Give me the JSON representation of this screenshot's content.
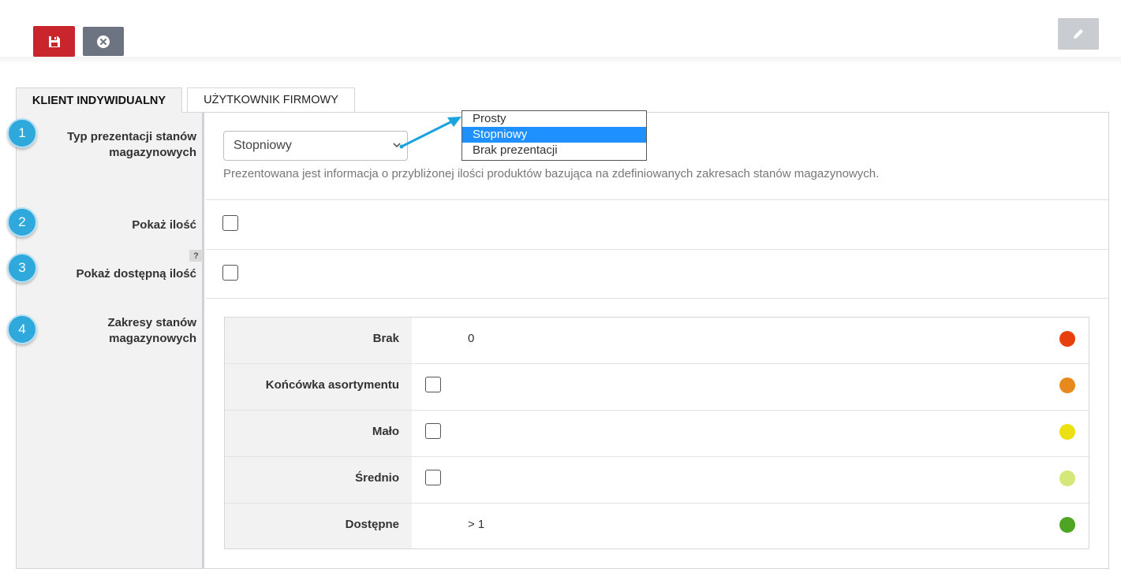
{
  "toolbar": {
    "save_icon": "floppy-disk-icon",
    "cancel_icon": "circle-x-icon",
    "edit_icon": "pencil-icon"
  },
  "tabs": [
    {
      "label": "KLIENT INDYWIDUALNY",
      "active": true
    },
    {
      "label": "UŻYTKOWNIK FIRMOWY",
      "active": false
    }
  ],
  "steps": [
    "1",
    "2",
    "3",
    "4"
  ],
  "fields": {
    "presentation_type": {
      "label_line1": "Typ prezentacji stanów",
      "label_line2": "magazynowych",
      "selected": "Stopniowy",
      "options": [
        "Prosty",
        "Stopniowy",
        "Brak prezentacji"
      ],
      "description": "Prezentowana jest informacja o przybliżonej ilości produktów bazująca na zdefiniowanych zakresach stanów magazynowych."
    },
    "show_quantity": {
      "label": "Pokaż ilość",
      "checked": false
    },
    "show_available": {
      "label": "Pokaż dostępną ilość",
      "checked": false,
      "help": "?"
    },
    "ranges": {
      "label_line1": "Zakresy stanów",
      "label_line2": "magazynowych",
      "rows": [
        {
          "label": "Brak",
          "value": "0",
          "color": "#e8400c"
        },
        {
          "label": "Końcówka asortymentu",
          "checkbox": true,
          "color": "#e8891e"
        },
        {
          "label": "Mało",
          "checkbox": true,
          "color": "#ede012"
        },
        {
          "label": "Średnio",
          "checkbox": true,
          "color": "#d4e87a"
        },
        {
          "label": "Dostępne",
          "value": "> 1",
          "color": "#4ea524"
        }
      ]
    }
  },
  "colors": {
    "save": "#c9252c",
    "cancel": "#6b7480",
    "edit": "#c9ccd1",
    "badge": "#2fa8dc",
    "dropdown_selected": "#1e90ff"
  }
}
